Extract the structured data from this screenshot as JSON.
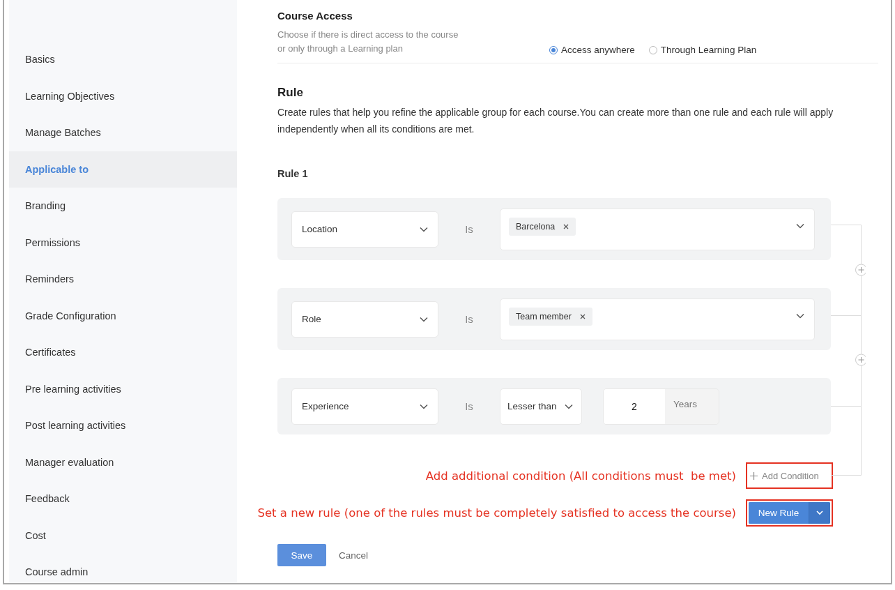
{
  "sidebar": {
    "items": [
      {
        "label": "Basics",
        "selected": false
      },
      {
        "label": "Learning Objectives",
        "selected": false
      },
      {
        "label": "Manage Batches",
        "selected": false
      },
      {
        "label": "Applicable to",
        "selected": true
      },
      {
        "label": "Branding",
        "selected": false
      },
      {
        "label": "Permissions",
        "selected": false
      },
      {
        "label": "Reminders",
        "selected": false
      },
      {
        "label": "Grade Configuration",
        "selected": false
      },
      {
        "label": "Certificates",
        "selected": false
      },
      {
        "label": "Pre learning activities",
        "selected": false
      },
      {
        "label": "Post learning activities",
        "selected": false
      },
      {
        "label": "Manager evaluation",
        "selected": false
      },
      {
        "label": "Feedback",
        "selected": false
      },
      {
        "label": "Cost",
        "selected": false
      },
      {
        "label": "Course admin",
        "selected": false
      }
    ]
  },
  "course_access": {
    "title": "Course Access",
    "description_lines": [
      "Choose if there is direct access to the course",
      "or only through a Learning plan"
    ],
    "options": [
      {
        "label": "Access anywhere",
        "selected": true
      },
      {
        "label": "Through Learning Plan",
        "selected": false
      }
    ]
  },
  "rule_section": {
    "title": "Rule",
    "description": "Create rules that help you refine the applicable group for each course.You can create more than one rule and each rule will apply independently when all its conditions are met.",
    "rules": [
      {
        "title": "Rule 1",
        "conditions": [
          {
            "kind": "multi",
            "field": "Location",
            "operator": "Is",
            "tags": [
              "Barcelona"
            ]
          },
          {
            "kind": "multi",
            "field": "Role",
            "operator": "Is",
            "tags": [
              "Team member"
            ]
          },
          {
            "kind": "compare",
            "field": "Experience",
            "operator": "Is",
            "comparator": "Lesser than",
            "value": "2",
            "unit": "Years"
          }
        ]
      }
    ],
    "add_condition": {
      "label": "Add Condition",
      "annotation": "Add additional condition (All conditions must  be met)"
    },
    "new_rule": {
      "label": "New Rule",
      "annotation": "Set a new rule (one of the rules must be completely satisfied to access the course)"
    }
  },
  "buttons": {
    "save": "Save",
    "cancel": "Cancel"
  }
}
